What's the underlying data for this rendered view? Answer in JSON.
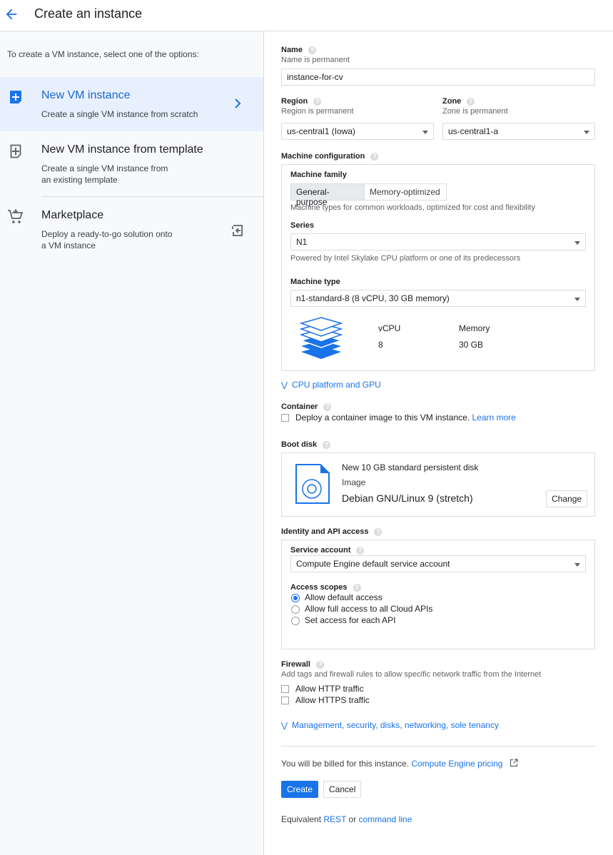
{
  "header": {
    "title": "Create an instance"
  },
  "left": {
    "intro": "To create a VM instance, select one of the options:",
    "options": [
      {
        "title": "New VM instance",
        "desc": "Create a single VM instance from scratch"
      },
      {
        "title": "New VM instance from template",
        "desc_line1": "Create a single VM instance from",
        "desc_line2": "an existing template"
      },
      {
        "title": "Marketplace",
        "desc_line1": "Deploy a ready-to-go solution onto",
        "desc_line2": "a VM instance"
      }
    ]
  },
  "form": {
    "name": {
      "label": "Name",
      "hint": "Name is permanent",
      "value": "instance-for-cv"
    },
    "region": {
      "label": "Region",
      "hint": "Region is permanent",
      "value": "us-central1 (Iowa)"
    },
    "zone": {
      "label": "Zone",
      "hint": "Zone is permanent",
      "value": "us-central1-a"
    },
    "machine": {
      "label": "Machine configuration",
      "family_label": "Machine family",
      "families": [
        "General-purpose",
        "Memory-optimized"
      ],
      "family_desc": "Machine types for common workloads, optimized for cost and flexibility",
      "series_label": "Series",
      "series_value": "N1",
      "series_desc": "Powered by Intel Skylake CPU platform or one of its predecessors",
      "type_label": "Machine type",
      "type_value": "n1-standard-8 (8 vCPU, 30 GB memory)",
      "vcpu_label": "vCPU",
      "vcpu_value": "8",
      "memory_label": "Memory",
      "memory_value": "30 GB"
    },
    "cpu_platform_link": "CPU platform and GPU",
    "container": {
      "label": "Container",
      "text": "Deploy a container image to this VM instance.",
      "link": "Learn more"
    },
    "boot_disk": {
      "label": "Boot disk",
      "title": "New 10 GB standard persistent disk",
      "image_label": "Image",
      "image_value": "Debian GNU/Linux 9 (stretch)",
      "change": "Change"
    },
    "identity": {
      "label": "Identity and API access",
      "sa_label": "Service account",
      "sa_value": "Compute Engine default service account",
      "scopes_label": "Access scopes",
      "scopes": [
        "Allow default access",
        "Allow full access to all Cloud APIs",
        "Set access for each API"
      ]
    },
    "firewall": {
      "label": "Firewall",
      "hint": "Add tags and firewall rules to allow specific network traffic from the Internet",
      "http": "Allow HTTP traffic",
      "https": "Allow HTTPS traffic"
    },
    "mgmt_link": "Management, security, disks, networking, sole tenancy",
    "billing": {
      "text": "You will be billed for this instance.",
      "link": "Compute Engine pricing"
    },
    "create": "Create",
    "cancel": "Cancel",
    "equivalent": {
      "text": "Equivalent",
      "rest": "REST",
      "or": "or",
      "cmd": "command line"
    }
  },
  "colors": {
    "accent": "#1a73e8",
    "selected_bg": "#e8f0fe",
    "sidebar_bg": "#f8f9fa"
  }
}
